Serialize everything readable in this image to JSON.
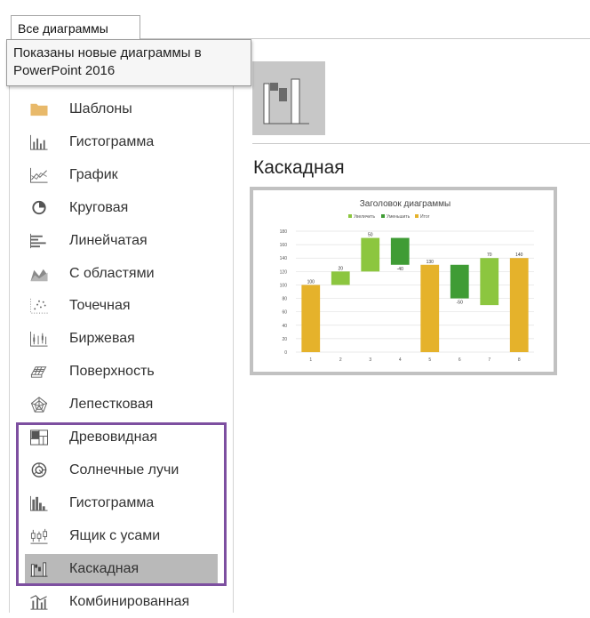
{
  "tab": {
    "label": "Все диаграммы"
  },
  "tooltip": {
    "text_line1": "Показаны новые диаграммы в",
    "text_line2": "PowerPoint 2016"
  },
  "chart_types": [
    {
      "label": "Шаблоны",
      "icon": "folder-icon"
    },
    {
      "label": "Гистограмма",
      "icon": "column-chart-icon"
    },
    {
      "label": "График",
      "icon": "line-chart-icon"
    },
    {
      "label": "Круговая",
      "icon": "pie-chart-icon"
    },
    {
      "label": "Линейчатая",
      "icon": "bar-chart-icon"
    },
    {
      "label": "С областями",
      "icon": "area-chart-icon"
    },
    {
      "label": "Точечная",
      "icon": "scatter-chart-icon"
    },
    {
      "label": "Биржевая",
      "icon": "stock-chart-icon"
    },
    {
      "label": "Поверхность",
      "icon": "surface-chart-icon"
    },
    {
      "label": "Лепестковая",
      "icon": "radar-chart-icon"
    },
    {
      "label": "Древовидная",
      "icon": "treemap-chart-icon"
    },
    {
      "label": "Солнечные лучи",
      "icon": "sunburst-chart-icon"
    },
    {
      "label": "Гистограмма",
      "icon": "histogram-chart-icon"
    },
    {
      "label": "Ящик с усами",
      "icon": "box-whisker-chart-icon"
    },
    {
      "label": "Каскадная",
      "icon": "waterfall-chart-icon",
      "selected": true
    },
    {
      "label": "Комбинированная",
      "icon": "combo-chart-icon"
    }
  ],
  "selected_type_title": "Каскадная",
  "colors": {
    "increase": "#8cc63f",
    "decrease": "#3f9c35",
    "total": "#e5b22b",
    "highlight": "#7d4fa0"
  },
  "chart_data": {
    "type": "bar",
    "subtype": "waterfall",
    "title": "Заголовок диаграммы",
    "legend": [
      "Увеличить",
      "Уменьшить",
      "Итог"
    ],
    "legend_position": "top",
    "categories": [
      "1",
      "2",
      "3",
      "4",
      "5",
      "6",
      "7",
      "8"
    ],
    "values": [
      100,
      20,
      50,
      -40,
      130,
      -50,
      70,
      140
    ],
    "data_labels": [
      "100",
      "20",
      "50",
      "-40",
      "130",
      "-50",
      "70",
      "140"
    ],
    "kinds": [
      "total",
      "increase",
      "increase",
      "decrease",
      "total",
      "decrease",
      "increase",
      "total"
    ],
    "ranges": [
      [
        0,
        100
      ],
      [
        100,
        120
      ],
      [
        120,
        170
      ],
      [
        130,
        170
      ],
      [
        0,
        130
      ],
      [
        80,
        130
      ],
      [
        70,
        140
      ],
      [
        0,
        140
      ]
    ],
    "yticks": [
      "0",
      "20",
      "40",
      "60",
      "80",
      "100",
      "120",
      "140",
      "160",
      "180"
    ],
    "ylim": [
      0,
      180
    ],
    "grid": true
  }
}
